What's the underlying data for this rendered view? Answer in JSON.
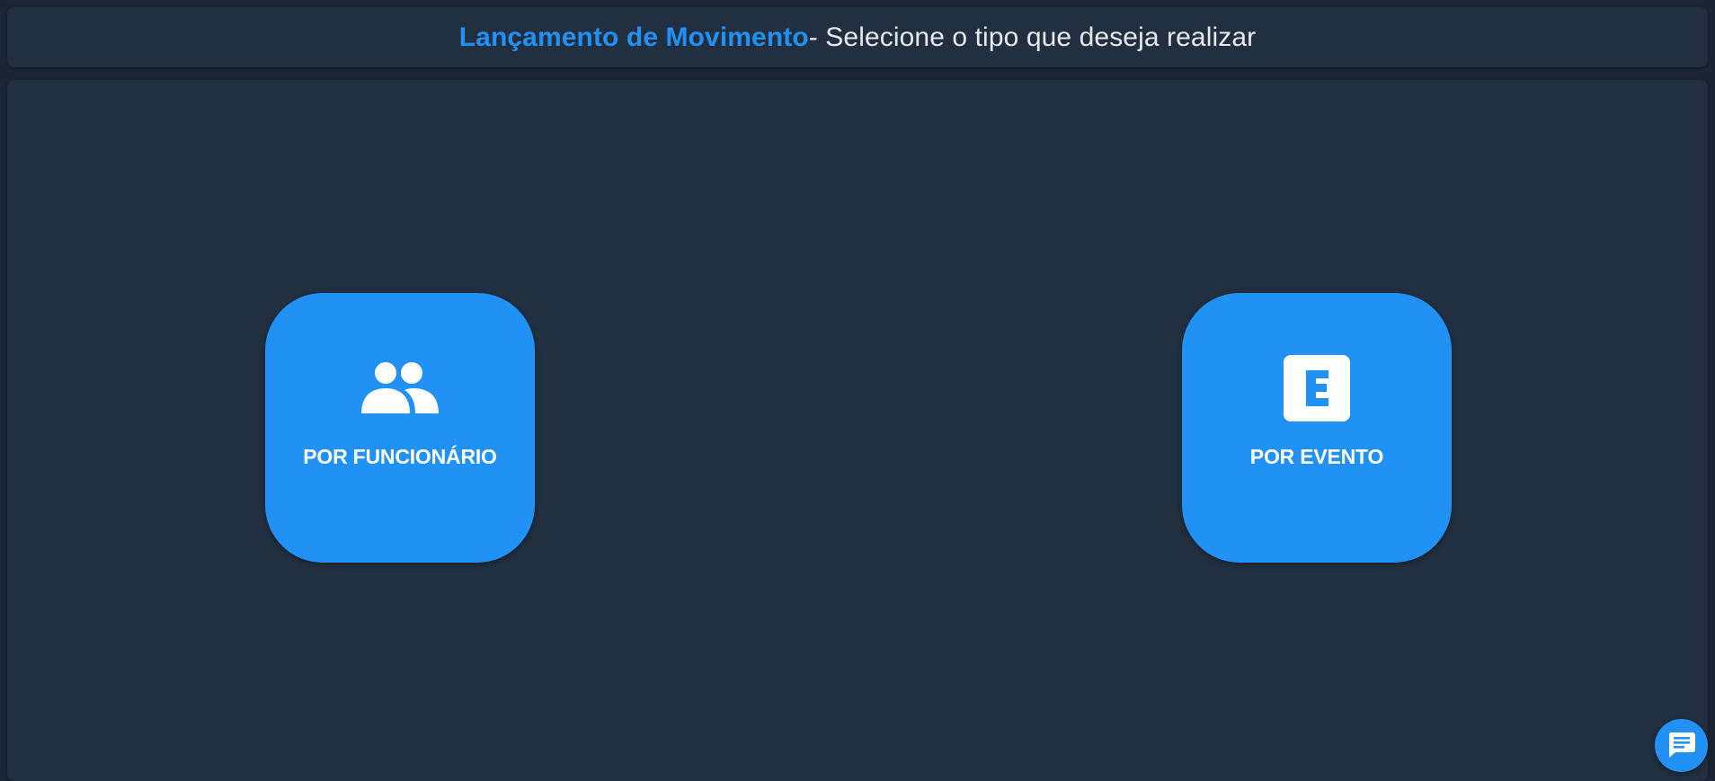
{
  "header": {
    "title": "Lançamento de Movimento",
    "separator": "-",
    "subtitle": " Selecione o tipo que deseja realizar"
  },
  "options": [
    {
      "label": "POR FUNCIONÁRIO",
      "icon": "people-icon"
    },
    {
      "label": "POR EVENTO",
      "icon": "event-e-icon"
    }
  ],
  "chat": {
    "icon": "chat-icon"
  },
  "colors": {
    "accent": "#2291f5",
    "background": "#1b2533",
    "panel": "#222f40",
    "text_light": "#e6e9ee",
    "white": "#ffffff"
  }
}
